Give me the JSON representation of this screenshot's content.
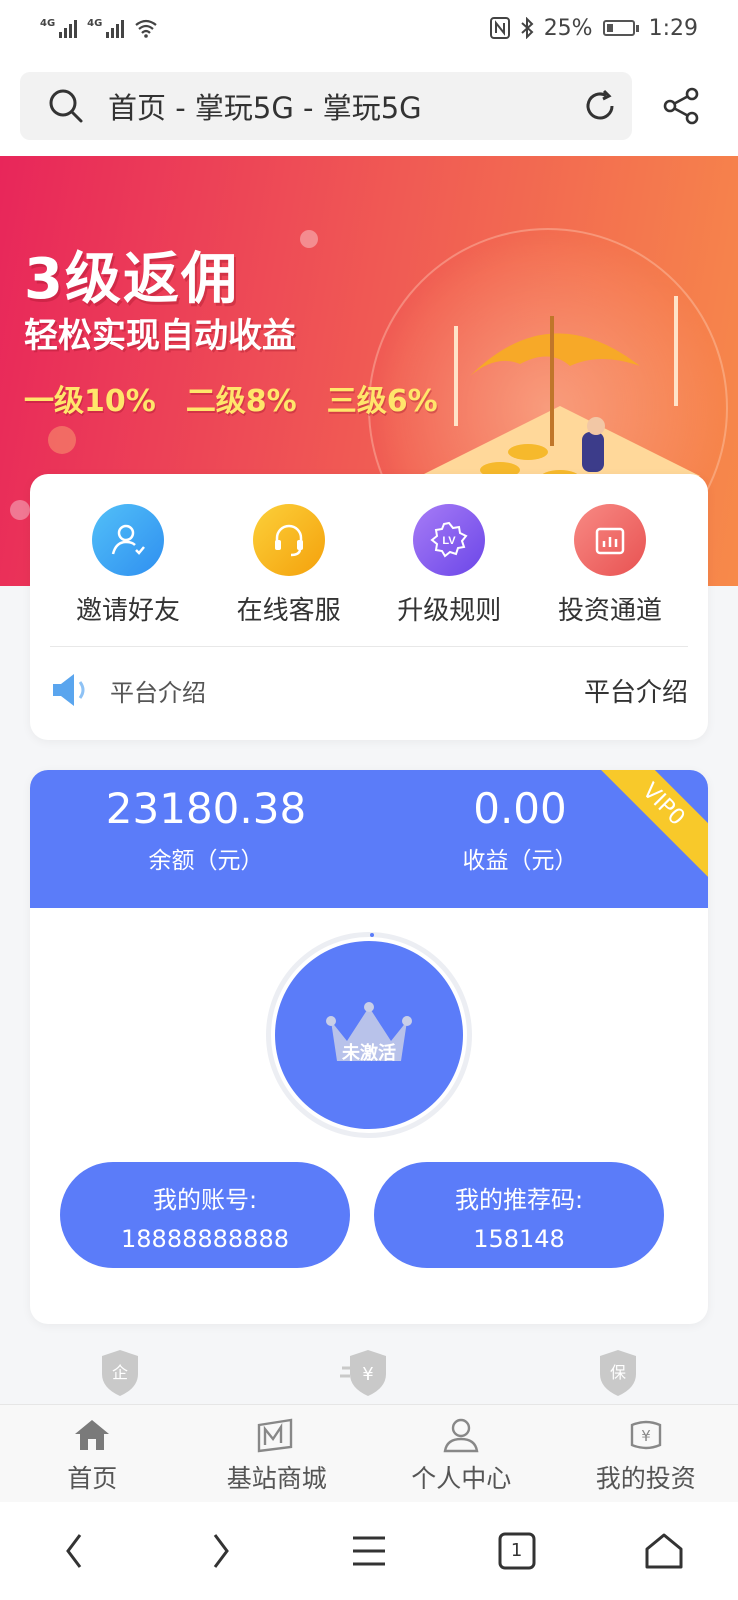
{
  "status_bar": {
    "network1": "4G",
    "network2": "4G",
    "battery": "25%",
    "time": "1:29"
  },
  "address_bar": {
    "title": "首页 - 掌玩5G - 掌玩5G"
  },
  "banner": {
    "headline": "3级返佣",
    "subline": "轻松实现自动收益",
    "levels": [
      "一级10%",
      "二级8%",
      "三级6%"
    ]
  },
  "menu": [
    {
      "label": "邀请好友",
      "icon": "invite-friend-icon",
      "color": "#3aa3f0"
    },
    {
      "label": "在线客服",
      "icon": "customer-service-icon",
      "color": "#f7b21a"
    },
    {
      "label": "升级规则",
      "icon": "upgrade-rules-icon",
      "color": "#8a5cf0"
    },
    {
      "label": "投资通道",
      "icon": "investment-channel-icon",
      "color": "#f0706e"
    }
  ],
  "notice": {
    "text": "平台介绍",
    "right": "平台介绍"
  },
  "account": {
    "balance": "23180.38",
    "balance_label": "余额（元）",
    "income": "0.00",
    "income_label": "收益（元）",
    "vip": "VIP0",
    "status": "未激活",
    "account_label": "我的账号:",
    "account_value": "18888888888",
    "ref_label": "我的推荐码:",
    "ref_value": "158148"
  },
  "badges": [
    {
      "glyph": "企",
      "icon": "enterprise-badge-icon"
    },
    {
      "glyph": "¥",
      "icon": "yuan-badge-icon"
    },
    {
      "glyph": "保",
      "icon": "insurance-badge-icon"
    }
  ],
  "tabs": [
    {
      "label": "首页",
      "icon": "home-icon"
    },
    {
      "label": "基站商城",
      "icon": "store-icon"
    },
    {
      "label": "个人中心",
      "icon": "user-icon"
    },
    {
      "label": "我的投资",
      "icon": "investment-icon"
    }
  ],
  "browser_nav": {
    "tab_count": "1"
  },
  "colors": {
    "primary": "#5b7cf9",
    "vip": "#f8c92a",
    "banner_start": "#e8265a",
    "banner_end": "#f78a4a"
  }
}
